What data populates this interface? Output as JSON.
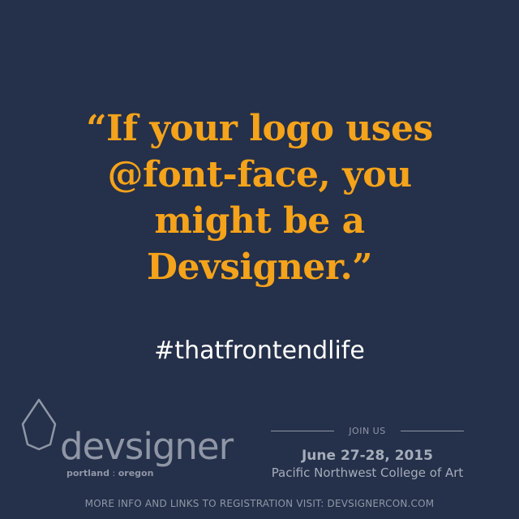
{
  "quote": {
    "lines": [
      "“If your logo uses",
      "@font-face, you",
      "might be a",
      "Devsigner.”"
    ]
  },
  "hashtag": "#thatfrontendlife",
  "logo": {
    "icon": "drop-outline-icon",
    "wordmark": "devsigner",
    "location_city": "portland",
    "location_sep": " : ",
    "location_state": "oregon"
  },
  "event": {
    "join_label": "JOIN US",
    "date": "June 27-28, 2015",
    "venue": "Pacific Northwest College of Art"
  },
  "footer": {
    "text": "MORE INFO AND LINKS TO REGISTRATION VISIT:  DEVSIGNERCON.COM"
  },
  "colors": {
    "background": "#25304a",
    "quote": "#f5a31a",
    "hashtag": "#ffffff",
    "muted": "#8f97a6"
  }
}
